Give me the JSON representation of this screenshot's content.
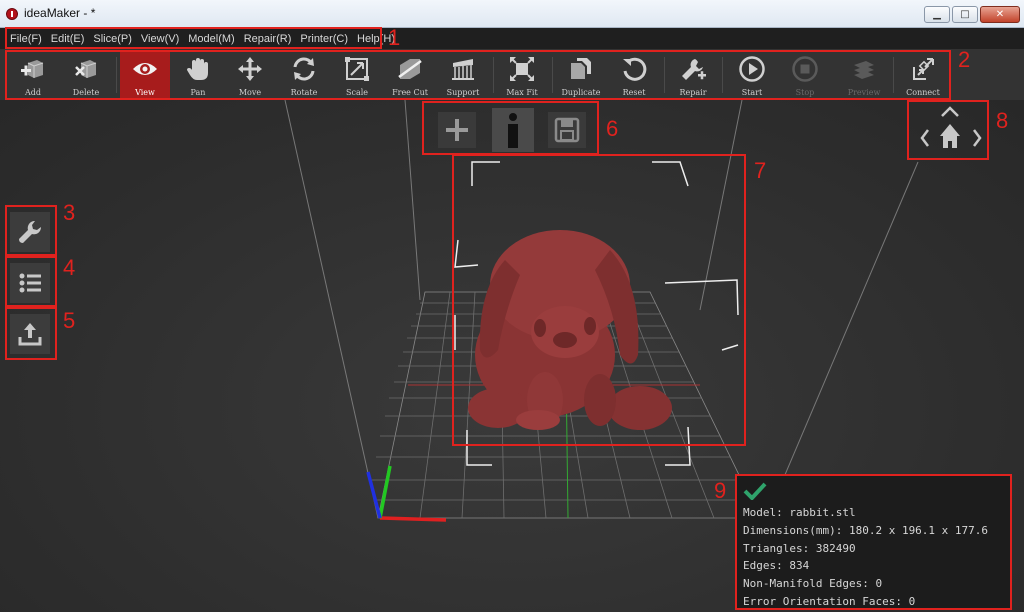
{
  "window": {
    "title": "ideaMaker -  *",
    "buttons": [
      "minimize",
      "maximize",
      "close"
    ]
  },
  "menu": [
    {
      "label": "File(F)"
    },
    {
      "label": "Edit(E)"
    },
    {
      "label": "Slice(P)"
    },
    {
      "label": "View(V)"
    },
    {
      "label": "Model(M)"
    },
    {
      "label": "Repair(R)"
    },
    {
      "label": "Printer(C)"
    },
    {
      "label": "Help(H)"
    }
  ],
  "toolbar": [
    {
      "label": "Add",
      "icon": "add-model-icon",
      "state": "normal"
    },
    {
      "label": "Delete",
      "icon": "delete-model-icon",
      "state": "normal"
    },
    {
      "label": "View",
      "icon": "eye-icon",
      "state": "active"
    },
    {
      "label": "Pan",
      "icon": "hand-icon",
      "state": "normal"
    },
    {
      "label": "Move",
      "icon": "move-arrows-icon",
      "state": "normal"
    },
    {
      "label": "Rotate",
      "icon": "rotate-icon",
      "state": "normal"
    },
    {
      "label": "Scale",
      "icon": "scale-icon",
      "state": "normal"
    },
    {
      "label": "Free Cut",
      "icon": "free-cut-icon",
      "state": "normal"
    },
    {
      "label": "Support",
      "icon": "support-icon",
      "state": "normal"
    },
    {
      "label": "Max Fit",
      "icon": "max-fit-icon",
      "state": "normal"
    },
    {
      "label": "Duplicate",
      "icon": "duplicate-icon",
      "state": "normal"
    },
    {
      "label": "Reset",
      "icon": "reset-icon",
      "state": "normal"
    },
    {
      "label": "Repair",
      "icon": "repair-icon",
      "state": "normal"
    },
    {
      "label": "Start",
      "icon": "play-icon",
      "state": "normal"
    },
    {
      "label": "Stop",
      "icon": "stop-icon",
      "state": "disabled"
    },
    {
      "label": "Preview",
      "icon": "preview-icon",
      "state": "disabled"
    },
    {
      "label": "Connect",
      "icon": "connect-icon",
      "state": "normal"
    }
  ],
  "side_panel": [
    {
      "icon": "wrench-icon"
    },
    {
      "icon": "list-icon"
    },
    {
      "icon": "upload-icon"
    }
  ],
  "overlay_buttons": [
    {
      "icon": "plus-icon"
    },
    {
      "icon": "info-icon"
    },
    {
      "icon": "save-icon"
    }
  ],
  "nav_widget": {
    "icons": [
      "chevron-up-icon",
      "chevron-left-icon",
      "home-icon",
      "chevron-right-icon"
    ]
  },
  "model_info": {
    "status_icon": "checkmark-icon",
    "status_color": "#2fa36b",
    "model": "Model: rabbit.stl",
    "dimensions": "Dimensions(mm): 180.2 x 196.1 x 177.6",
    "triangles": "Triangles: 382490",
    "edges": "Edges: 834",
    "non_manifold": "Non-Manifold Edges: 0",
    "error_faces": "Error Orientation Faces: 0"
  },
  "model_color": "#8a3434",
  "accent_color": "#a71c1c",
  "callouts": [
    "1",
    "2",
    "3",
    "4",
    "5",
    "6",
    "7",
    "8",
    "9"
  ]
}
